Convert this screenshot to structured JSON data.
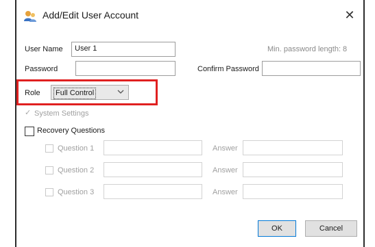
{
  "window": {
    "title": "Add/Edit User Account",
    "close_glyph": "✕",
    "icon": "users-icon"
  },
  "form": {
    "user_name_label": "User Name",
    "user_name_value": "User 1",
    "min_password_hint": "Min. password length: 8",
    "password_label": "Password",
    "password_value": "",
    "confirm_password_label": "Confirm Password",
    "confirm_password_value": "",
    "role_label": "Role",
    "role_value": "Full Control",
    "system_settings_label": "System Settings",
    "system_settings_checked": true,
    "recovery_questions_label": "Recovery Questions",
    "recovery_questions_checked": false,
    "questions": [
      {
        "label": "Question 1",
        "answer_label": "Answer"
      },
      {
        "label": "Question 2",
        "answer_label": "Answer"
      },
      {
        "label": "Question 3",
        "answer_label": "Answer"
      }
    ]
  },
  "buttons": {
    "ok_label": "OK",
    "cancel_label": "Cancel"
  },
  "colors": {
    "highlight": "#e02020",
    "default_button_border": "#0078d7"
  }
}
